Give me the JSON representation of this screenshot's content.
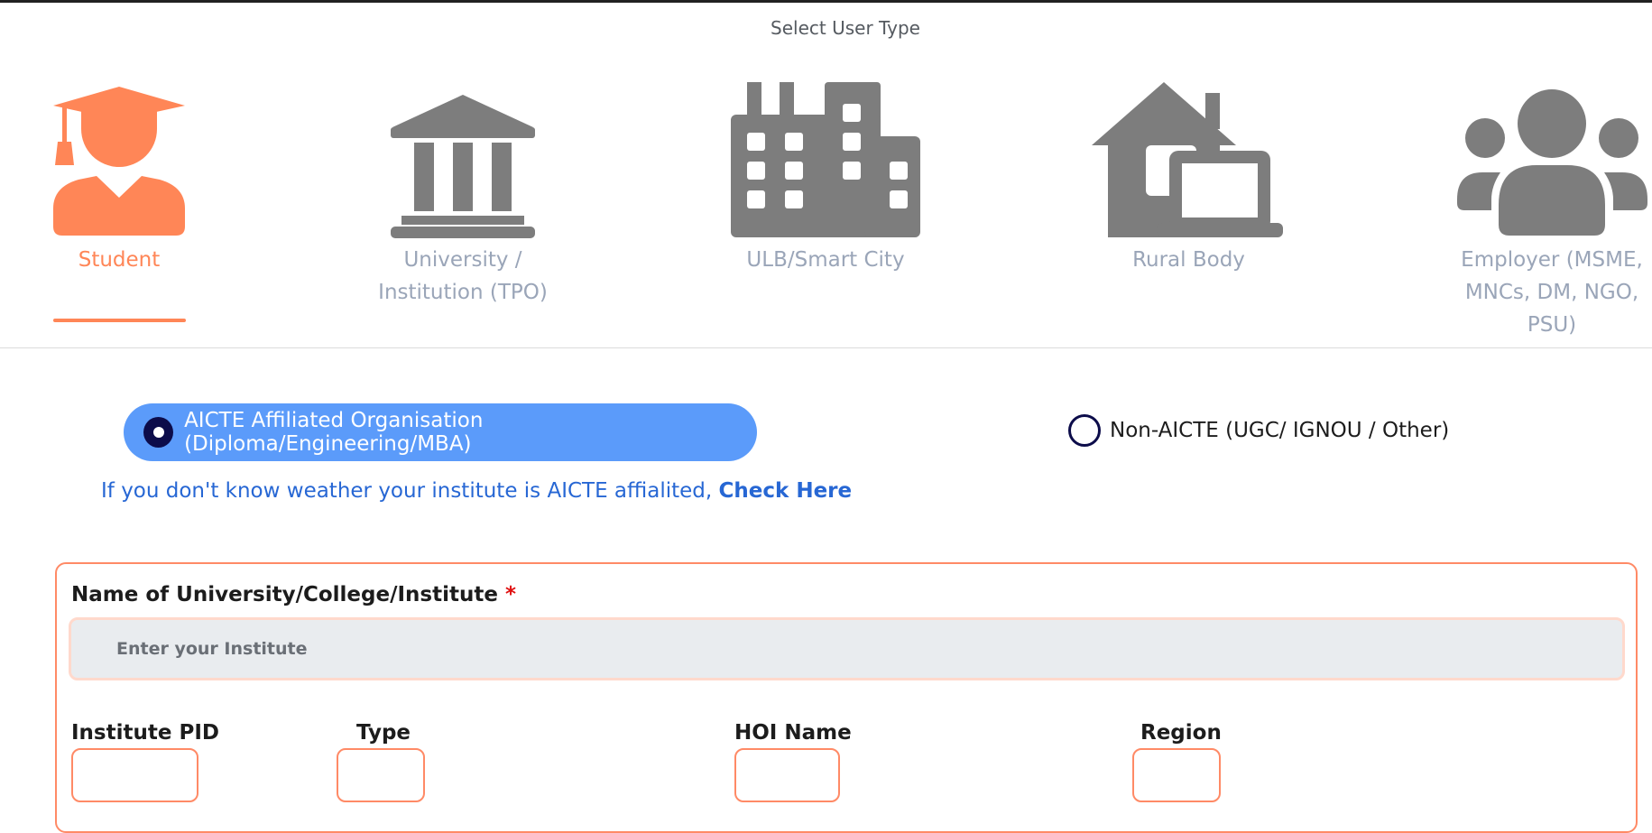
{
  "header": {
    "title": "Select User Type"
  },
  "user_types": [
    {
      "label": "Student",
      "icon": "graduate-icon",
      "active": true
    },
    {
      "label": "University / Institution (TPO)",
      "icon": "institution-building-icon",
      "active": false
    },
    {
      "label": "ULB/Smart City",
      "icon": "city-buildings-icon",
      "active": false
    },
    {
      "label": "Rural Body",
      "icon": "house-laptop-icon",
      "active": false
    },
    {
      "label": "Employer (MSME, MNCs, DM, NGO, PSU)",
      "icon": "people-group-icon",
      "active": false
    }
  ],
  "affiliation": {
    "aicte_label": "AICTE Affiliated Organisation (Diploma/Engineering/MBA)",
    "aicte_selected": true,
    "non_aicte_label": "Non-AICTE (UGC/ IGNOU / Other)",
    "hint_text": "If you don't know weather your institute is AICTE affialited, ",
    "hint_link": "Check Here"
  },
  "form": {
    "institute_label": "Name of University/College/Institute",
    "required_marker": "*",
    "institute_placeholder": "Enter your Institute",
    "fields": {
      "pid": "Institute PID",
      "type": "Type",
      "hoi": "HOI Name",
      "region": "Region"
    }
  },
  "colors": {
    "accent": "#ff8657",
    "inactive_icon": "#7d7d7d",
    "inactive_label": "#9aa5b8",
    "pill": "#5b9bfa",
    "link": "#2767d4"
  }
}
